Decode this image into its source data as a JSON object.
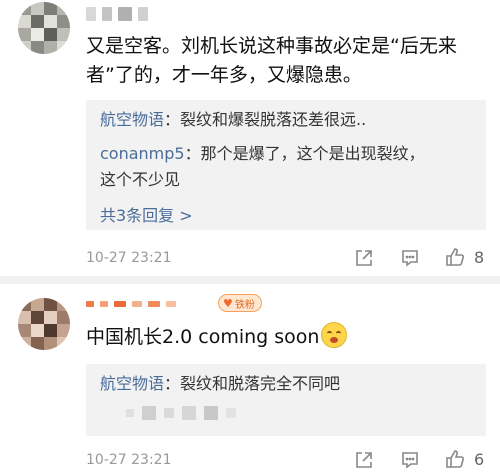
{
  "comments": [
    {
      "text": "又是空客。刘机长说这种事故必定是“后无来者”了的，才一年多，又爆隐患。",
      "replies": [
        {
          "user": "航空物语",
          "text": "：裂纹和爆裂脱落还差很远.."
        },
        {
          "user": "conanmp5",
          "text": "：那个是爆了，这个是出现裂纹，",
          "text2": "这个不少见"
        }
      ],
      "more_replies": "共3条回复 >",
      "time": "10-27 23:21",
      "like_count": "8"
    },
    {
      "badge": "铁粉",
      "text": "中国机长2.0 coming soon",
      "replies": [
        {
          "user": "航空物语",
          "text": "：裂纹和脱落完全不同吧"
        }
      ],
      "time": "10-27 23:21",
      "like_count": "6"
    }
  ],
  "icons": {
    "share": "share-icon",
    "comment": "comment-icon",
    "like": "thumbs-up-icon",
    "emoji": "shush-face-emoji"
  },
  "colors": {
    "username_link": "#4a6d99",
    "reply_bg": "#f2f2f2",
    "timestamp": "#999999",
    "badge": "#f4a15d"
  }
}
